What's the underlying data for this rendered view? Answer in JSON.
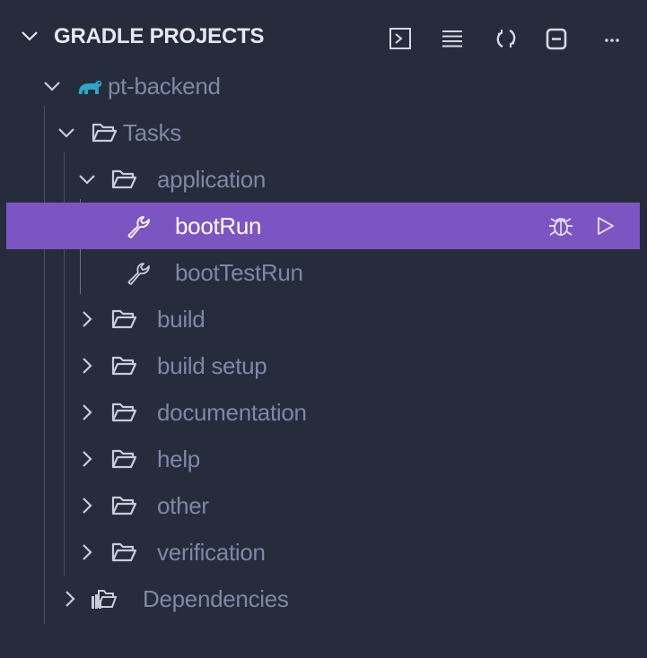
{
  "header": {
    "title": "GRADLE PROJECTS",
    "actions": [
      "terminal-icon",
      "list-icon",
      "refresh-icon",
      "collapse-all-icon",
      "more-icon"
    ]
  },
  "tree": {
    "project": "pt-backend",
    "tasks": "Tasks",
    "application": "application",
    "bootRun": "bootRun",
    "bootTestRun": "bootTestRun",
    "groups": [
      "build",
      "build setup",
      "documentation",
      "help",
      "other",
      "verification"
    ],
    "dependencies": "Dependencies"
  },
  "colors": {
    "background": "#262c3c",
    "selection": "#7c55c2",
    "text": "#7f87a8",
    "title": "#e6e8f1",
    "gradle_icon": "#2aa6c9"
  }
}
